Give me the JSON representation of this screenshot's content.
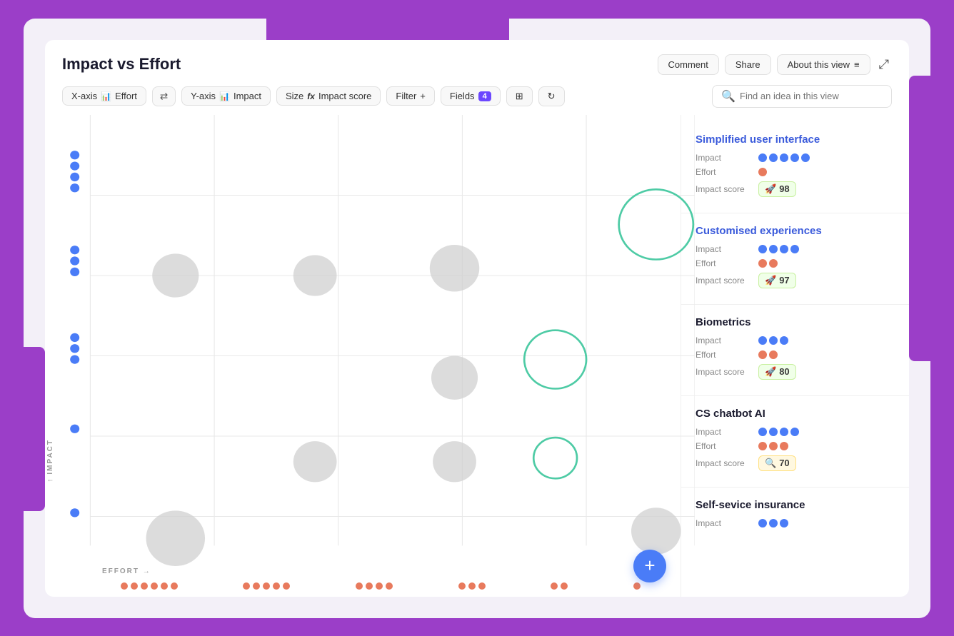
{
  "header": {
    "title": "Impact vs Effort",
    "comment_btn": "Comment",
    "share_btn": "Share",
    "about_btn": "About this view",
    "expand_icon": "⤢"
  },
  "toolbar": {
    "xaxis_label": "X-axis",
    "xaxis_value": "Effort",
    "swap_icon": "⇄",
    "yaxis_label": "Y-axis",
    "yaxis_value": "Impact",
    "size_label": "Size",
    "size_value": "Impact score",
    "filter_label": "Filter",
    "filter_plus": "+",
    "fields_label": "Fields",
    "fields_count": "4",
    "search_placeholder": "Find an idea in this view"
  },
  "features": [
    {
      "id": "f1",
      "title": "Simplified user interface",
      "title_color": "blue",
      "impact_dots": 5,
      "effort_dots": 1,
      "score": 98,
      "score_type": "green"
    },
    {
      "id": "f2",
      "title": "Customised experiences",
      "title_color": "blue",
      "impact_dots": 4,
      "effort_dots": 2,
      "score": 97,
      "score_type": "green"
    },
    {
      "id": "f3",
      "title": "Biometrics",
      "title_color": "normal",
      "impact_dots": 3,
      "effort_dots": 2,
      "score": 80,
      "score_type": "green"
    },
    {
      "id": "f4",
      "title": "CS chatbot AI",
      "title_color": "normal",
      "impact_dots": 4,
      "effort_dots": 3,
      "score": 70,
      "score_type": "yellow"
    },
    {
      "id": "f5",
      "title": "Self-sevice insurance",
      "title_color": "normal",
      "impact_dots": 3,
      "effort_dots": 0,
      "score": null,
      "score_type": "green"
    }
  ],
  "chart": {
    "xaxis": "EFFORT →",
    "yaxis": "IMPACT",
    "yaxis_arrow": "↑"
  }
}
